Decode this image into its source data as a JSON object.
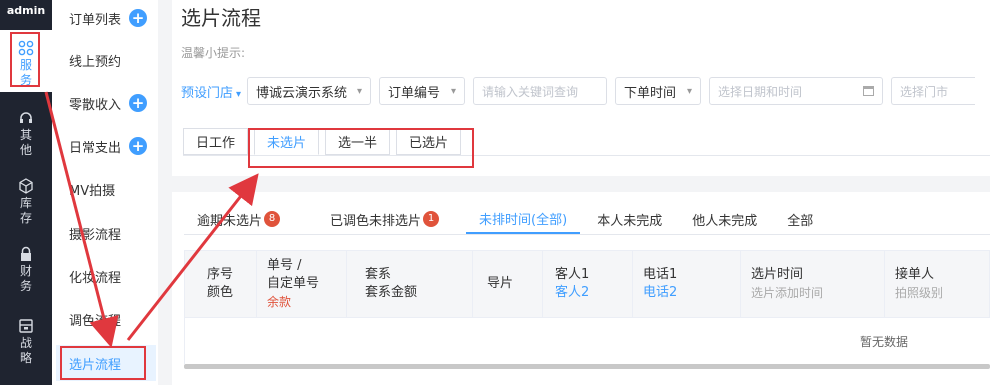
{
  "rail": {
    "user": "admin",
    "items": [
      {
        "label": "服务",
        "icon": "grid-icon"
      },
      {
        "label": "其他",
        "icon": "headset-icon"
      },
      {
        "label": "库存",
        "icon": "cube-icon"
      },
      {
        "label": "财务",
        "icon": "lock-icon"
      },
      {
        "label": "战略",
        "icon": "folder-icon"
      }
    ]
  },
  "submenu": {
    "items": [
      {
        "label": "订单列表",
        "plus": true
      },
      {
        "label": "线上预约",
        "plus": false
      },
      {
        "label": "零散收入",
        "plus": true
      },
      {
        "label": "日常支出",
        "plus": true
      },
      {
        "label": "MV拍摄",
        "plus": false
      },
      {
        "label": "摄影流程",
        "plus": false
      },
      {
        "label": "化妆流程",
        "plus": false
      },
      {
        "label": "调色流程",
        "plus": false
      },
      {
        "label": "选片流程",
        "plus": false
      }
    ],
    "plus_glyph": "+"
  },
  "page": {
    "title": "选片流程",
    "hint": "温馨小提示:"
  },
  "filters": {
    "store_link": "预设门店",
    "system_select": "博诚云演示系统",
    "order_field_select": "订单编号",
    "keyword_placeholder": "请输入关键词查询",
    "time_field_select": "下单时间",
    "date_placeholder": "选择日期和时间",
    "store_placeholder": "选择门市"
  },
  "stage_tabs": [
    "日工作",
    "未选片",
    "选一半",
    "已选片"
  ],
  "status_tabs": [
    {
      "label": "逾期未选片",
      "badge": "8"
    },
    {
      "label": "已调色未排选片",
      "badge": "1"
    },
    {
      "label": "未排时间(全部)",
      "badge": ""
    },
    {
      "label": "本人未完成",
      "badge": ""
    },
    {
      "label": "他人未完成",
      "badge": ""
    },
    {
      "label": "全部",
      "badge": ""
    }
  ],
  "table": {
    "headers": [
      {
        "l1": "序号",
        "l2": "颜色",
        "l3": ""
      },
      {
        "l1": "单号 /",
        "l2": "自定单号",
        "l3": "余款"
      },
      {
        "l1": "套系",
        "l2": "套系金额",
        "l3": ""
      },
      {
        "l1": "导片",
        "l2": "",
        "l3": ""
      },
      {
        "l1": "客人1",
        "l2": "客人2",
        "l3": ""
      },
      {
        "l1": "电话1",
        "l2": "电话2",
        "l3": ""
      },
      {
        "l1": "选片时间",
        "l2": "选片添加时间",
        "l3": ""
      },
      {
        "l1": "接单人",
        "l2": "拍照级别",
        "l3": ""
      }
    ],
    "empty_text": "暂无数据"
  },
  "colors": {
    "accent": "#409eff",
    "highlight": "#e0383e",
    "badge": "#e0533b",
    "rail_bg": "#1f2430"
  }
}
